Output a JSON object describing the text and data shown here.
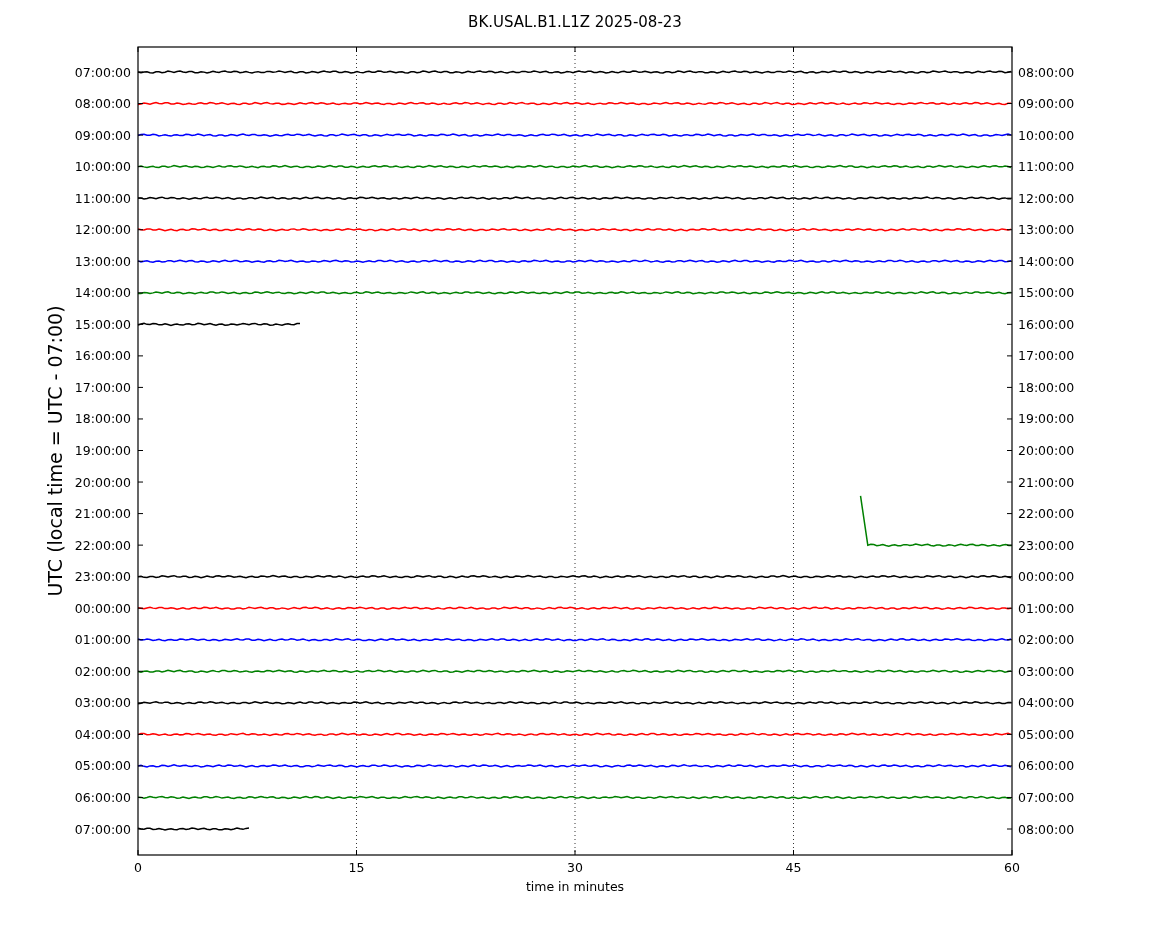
{
  "figure": {
    "title": "BK.USAL.B1.L1Z 2025-08-23",
    "xlabel": "time in minutes",
    "ylabel": "UTC (local time = UTC - 07:00)",
    "x_tick_labels": [
      "0",
      "15",
      "30",
      "45",
      "60"
    ],
    "rows": [
      {
        "left": "07:00:00",
        "right": "08:00:00",
        "kind": "full",
        "color": "#000000"
      },
      {
        "left": "08:00:00",
        "right": "09:00:00",
        "kind": "full",
        "color": "#ff0000"
      },
      {
        "left": "09:00:00",
        "right": "10:00:00",
        "kind": "full",
        "color": "#0000ff"
      },
      {
        "left": "10:00:00",
        "right": "11:00:00",
        "kind": "full",
        "color": "#008000"
      },
      {
        "left": "11:00:00",
        "right": "12:00:00",
        "kind": "full",
        "color": "#000000"
      },
      {
        "left": "12:00:00",
        "right": "13:00:00",
        "kind": "full",
        "color": "#ff0000"
      },
      {
        "left": "13:00:00",
        "right": "14:00:00",
        "kind": "full",
        "color": "#0000ff"
      },
      {
        "left": "14:00:00",
        "right": "15:00:00",
        "kind": "full",
        "color": "#008000"
      },
      {
        "left": "15:00:00",
        "right": "16:00:00",
        "kind": "partial",
        "color": "#000000",
        "level": 0.187
      },
      {
        "left": "16:00:00",
        "right": "17:00:00",
        "kind": "none"
      },
      {
        "left": "17:00:00",
        "right": "18:00:00",
        "kind": "none"
      },
      {
        "left": "18:00:00",
        "right": "19:00:00",
        "kind": "none"
      },
      {
        "left": "19:00:00",
        "right": "20:00:00",
        "kind": "none"
      },
      {
        "left": "20:00:00",
        "right": "21:00:00",
        "kind": "none"
      },
      {
        "left": "21:00:00",
        "right": "22:00:00",
        "kind": "none"
      },
      {
        "left": "22:00:00",
        "right": "23:00:00",
        "kind": "step",
        "color": "#008000"
      },
      {
        "left": "23:00:00",
        "right": "00:00:00",
        "kind": "full",
        "color": "#000000"
      },
      {
        "left": "00:00:00",
        "right": "01:00:00",
        "kind": "full",
        "color": "#ff0000"
      },
      {
        "left": "01:00:00",
        "right": "02:00:00",
        "kind": "full",
        "color": "#0000ff"
      },
      {
        "left": "02:00:00",
        "right": "03:00:00",
        "kind": "full",
        "color": "#008000"
      },
      {
        "left": "03:00:00",
        "right": "04:00:00",
        "kind": "full",
        "color": "#000000"
      },
      {
        "left": "04:00:00",
        "right": "05:00:00",
        "kind": "full",
        "color": "#ff0000"
      },
      {
        "left": "05:00:00",
        "right": "06:00:00",
        "kind": "full",
        "color": "#0000ff"
      },
      {
        "left": "06:00:00",
        "right": "07:00:00",
        "kind": "full",
        "color": "#008000"
      },
      {
        "left": "07:00:00",
        "right": "08:00:00",
        "kind": "partial",
        "color": "#000000",
        "level": 0.13
      }
    ]
  }
}
